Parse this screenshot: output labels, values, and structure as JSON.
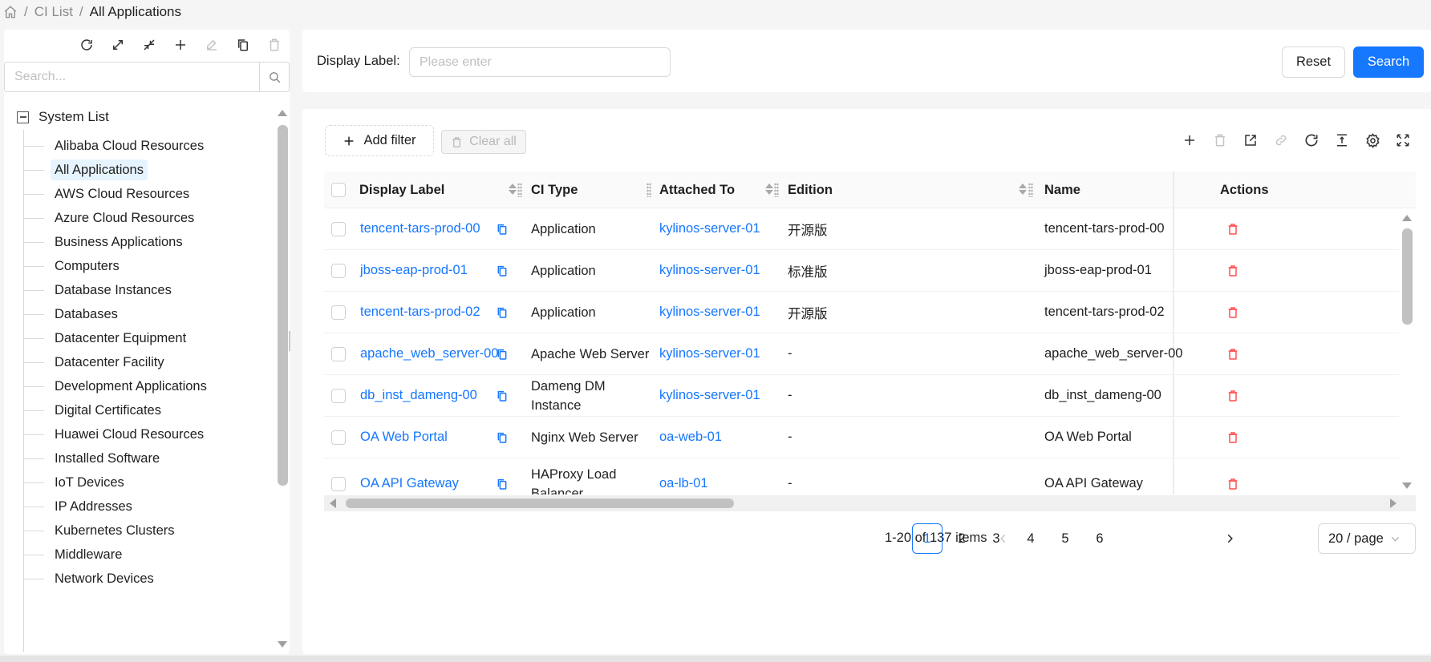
{
  "breadcrumb": {
    "sep": "/",
    "items": [
      "CI List",
      "All Applications"
    ]
  },
  "left_panel": {
    "toolbar_icons": [
      "refresh-icon",
      "expand-icon",
      "collapse-icon",
      "plus-icon",
      "edit-icon",
      "copy-icon",
      "trash-icon"
    ],
    "search_placeholder": "Search...",
    "tree_root": "System List",
    "tree_items": [
      "Alibaba Cloud Resources",
      "All Applications",
      "AWS Cloud Resources",
      "Azure Cloud Resources",
      "Business Applications",
      "Computers",
      "Database Instances",
      "Databases",
      "Datacenter Equipment",
      "Datacenter Facility",
      "Development Applications",
      "Digital Certificates",
      "Huawei Cloud Resources",
      "Installed Software",
      "IoT Devices",
      "IP Addresses",
      "Kubernetes Clusters",
      "Middleware",
      "Network Devices"
    ],
    "selected_item": "All Applications"
  },
  "filter": {
    "label": "Display Label",
    "label_colon": ":",
    "placeholder": "Please enter",
    "reset_label": "Reset",
    "search_label": "Search"
  },
  "table_toolbar": {
    "add_filter_label": "Add filter",
    "clear_all_label": "Clear all",
    "icons": [
      "plus-icon",
      "trash-icon",
      "export-icon",
      "link-icon",
      "refresh-icon",
      "column-height-icon",
      "settings-icon",
      "fullscreen-icon"
    ]
  },
  "table": {
    "columns": [
      "Display Label",
      "CI Type",
      "Attached To",
      "Edition",
      "Name",
      "Actions"
    ],
    "rows": [
      {
        "display_label": "tencent-tars-prod-00",
        "ci_type": "Application",
        "attached_to": "kylinos-server-01",
        "edition": "开源版",
        "name": "tencent-tars-prod-00"
      },
      {
        "display_label": "jboss-eap-prod-01",
        "ci_type": "Application",
        "attached_to": "kylinos-server-01",
        "edition": "标准版",
        "name": "jboss-eap-prod-01"
      },
      {
        "display_label": "tencent-tars-prod-02",
        "ci_type": "Application",
        "attached_to": "kylinos-server-01",
        "edition": "开源版",
        "name": "tencent-tars-prod-02"
      },
      {
        "display_label": "apache_web_server-00",
        "ci_type": "Apache Web Server",
        "attached_to": "kylinos-server-01",
        "edition": "-",
        "name": "apache_web_server-00"
      },
      {
        "display_label": "db_inst_dameng-00",
        "ci_type": "Dameng DM Instance",
        "attached_to": "kylinos-server-01",
        "edition": "-",
        "name": "db_inst_dameng-00"
      },
      {
        "display_label": "OA Web Portal",
        "ci_type": "Nginx Web Server",
        "attached_to": "oa-web-01",
        "edition": "-",
        "name": "OA Web Portal"
      },
      {
        "display_label": "OA API Gateway",
        "ci_type": "HAProxy Load Balancer",
        "attached_to": "oa-lb-01",
        "edition": "-",
        "name": "OA API Gateway"
      }
    ]
  },
  "pagination": {
    "total_text": "1-20 of 137 items",
    "pages": [
      "1",
      "2",
      "3",
      "4",
      "5",
      "6"
    ],
    "current_page": "1",
    "page_size": "20 / page"
  },
  "colors": {
    "primary": "#1677ff",
    "danger": "#ff4d4f",
    "link": "#1677ff"
  }
}
